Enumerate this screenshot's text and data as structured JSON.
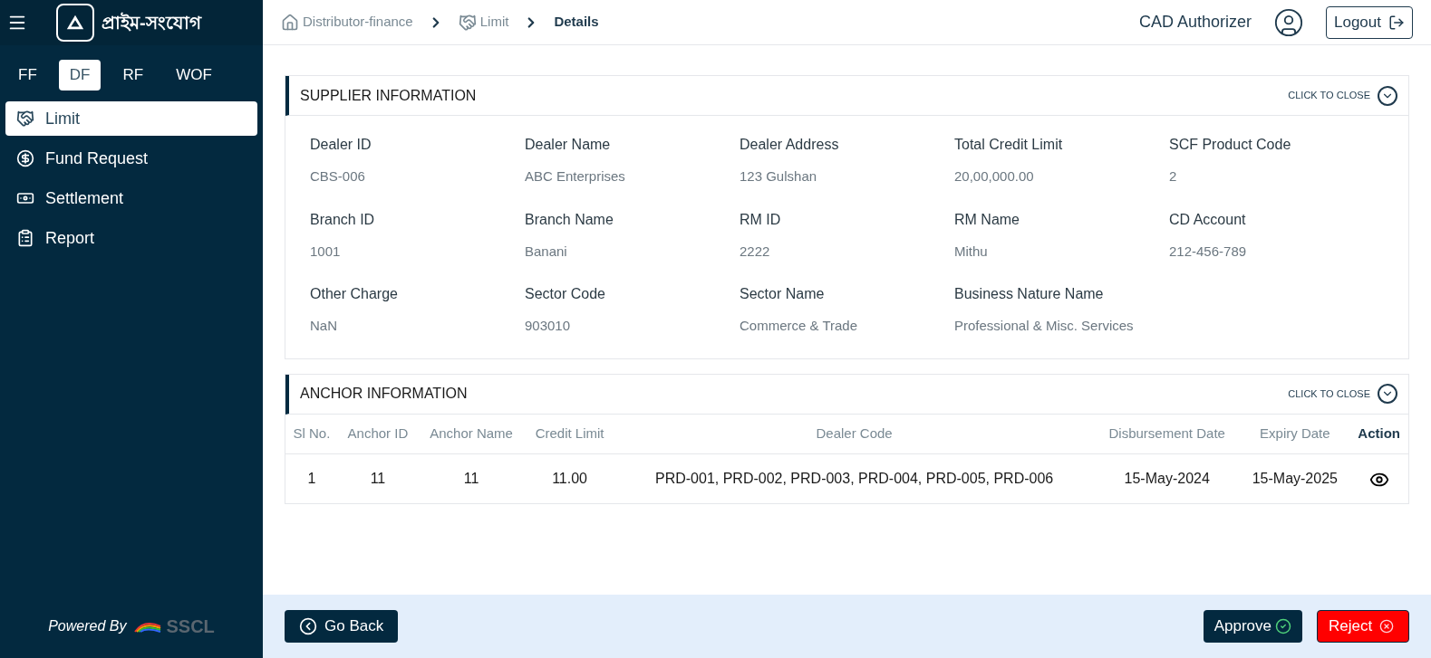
{
  "sidebar": {
    "brand": "প্রাইম-সংযোগ",
    "product_tabs": [
      {
        "label": "FF",
        "selected": false
      },
      {
        "label": "DF",
        "selected": true
      },
      {
        "label": "RF",
        "selected": false
      },
      {
        "label": "WOF",
        "selected": false
      }
    ],
    "items": [
      {
        "label": "Limit",
        "kind": "handshake",
        "selected": true
      },
      {
        "label": "Fund Request",
        "kind": "dollar",
        "selected": false
      },
      {
        "label": "Settlement",
        "kind": "cash",
        "selected": false
      },
      {
        "label": "Report",
        "kind": "clipboard",
        "selected": false
      }
    ],
    "footer": {
      "text": "Powered By",
      "logo": "SSCL"
    }
  },
  "header": {
    "breadcrumbs": [
      {
        "label": "Distributor-finance",
        "kind": "home"
      },
      {
        "label": "Limit",
        "kind": "handshake"
      },
      {
        "label": "Details",
        "kind": "current"
      }
    ],
    "user": "CAD Authorizer",
    "logout": "Logout"
  },
  "supplier": {
    "title": "SUPPLIER INFORMATION",
    "toggle": "CLICK TO CLOSE",
    "fields": [
      {
        "label": "Dealer ID",
        "value": "CBS-006"
      },
      {
        "label": "Dealer Name",
        "value": "ABC Enterprises"
      },
      {
        "label": "Dealer Address",
        "value": "123 Gulshan"
      },
      {
        "label": "Total Credit Limit",
        "value": "20,00,000.00"
      },
      {
        "label": "SCF Product Code",
        "value": "2"
      },
      {
        "label": "Branch ID",
        "value": "1001"
      },
      {
        "label": "Branch Name",
        "value": "Banani"
      },
      {
        "label": "RM ID",
        "value": "2222"
      },
      {
        "label": "RM Name",
        "value": "Mithu"
      },
      {
        "label": "CD Account",
        "value": "212-456-789"
      },
      {
        "label": "Other Charge",
        "value": "NaN"
      },
      {
        "label": "Sector Code",
        "value": "903010"
      },
      {
        "label": "Sector Name",
        "value": "Commerce & Trade"
      },
      {
        "label": "Business Nature Name",
        "value": "Professional & Misc. Services"
      }
    ]
  },
  "anchor": {
    "title": "ANCHOR INFORMATION",
    "toggle": "CLICK TO CLOSE",
    "table": {
      "columns": [
        "Sl No.",
        "Anchor ID",
        "Anchor Name",
        "Credit Limit",
        "Dealer Code",
        "Disbursement Date",
        "Expiry Date",
        "Action"
      ],
      "rows": [
        {
          "cells": [
            "1",
            "11",
            "11",
            "11.00",
            "PRD-001, PRD-002, PRD-003, PRD-004, PRD-005, PRD-006",
            "15-May-2024",
            "15-May-2025"
          ]
        }
      ]
    }
  },
  "footer": {
    "back": "Go Back",
    "approve": "Approve",
    "reject": "Reject"
  }
}
